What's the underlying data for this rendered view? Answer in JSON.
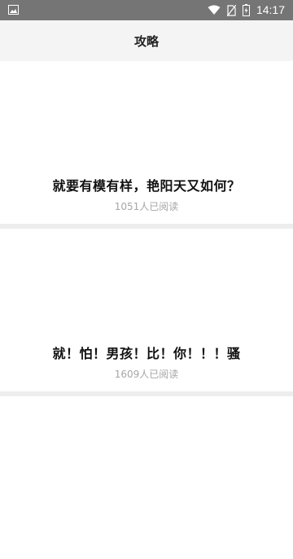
{
  "status_bar": {
    "time": "14:17",
    "icons": [
      "image-icon",
      "wifi-icon",
      "no-sim-icon",
      "battery-icon"
    ]
  },
  "header": {
    "title": "攻略"
  },
  "articles": [
    {
      "title": "就要有模有样，艳阳天又如何？",
      "read_count": "1051人已阅读"
    },
    {
      "title": "就！怕！男孩！比！你！！！骚",
      "read_count": "1609人已阅读"
    }
  ]
}
